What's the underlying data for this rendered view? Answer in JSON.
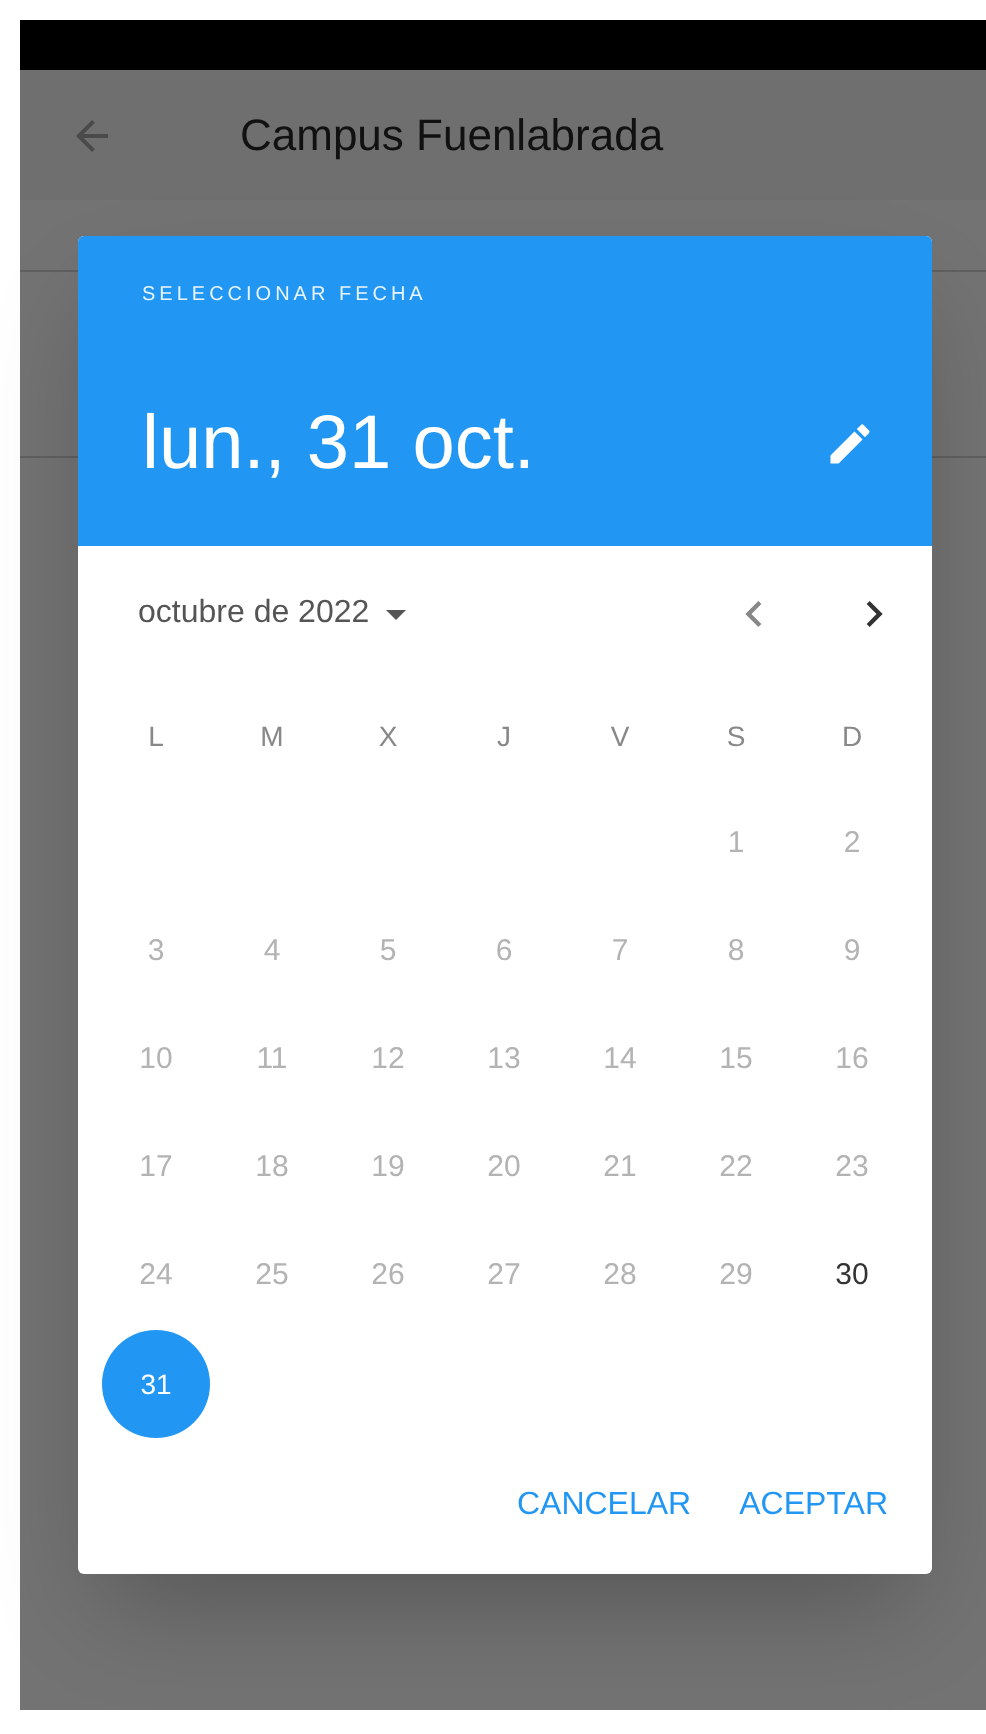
{
  "app_bar": {
    "title": "Campus Fuenlabrada"
  },
  "date_picker": {
    "header_label": "SELECCIONAR FECHA",
    "selected_date": "lun., 31 oct.",
    "month_label": "octubre de 2022",
    "weekdays": [
      "L",
      "M",
      "X",
      "J",
      "V",
      "S",
      "D"
    ],
    "weeks": [
      [
        {
          "kind": "blank"
        },
        {
          "kind": "blank"
        },
        {
          "kind": "blank"
        },
        {
          "kind": "blank"
        },
        {
          "kind": "blank"
        },
        {
          "kind": "day",
          "label": "1",
          "disabled": true,
          "selected": false
        },
        {
          "kind": "day",
          "label": "2",
          "disabled": true,
          "selected": false
        }
      ],
      [
        {
          "kind": "day",
          "label": "3",
          "disabled": true,
          "selected": false
        },
        {
          "kind": "day",
          "label": "4",
          "disabled": true,
          "selected": false
        },
        {
          "kind": "day",
          "label": "5",
          "disabled": true,
          "selected": false
        },
        {
          "kind": "day",
          "label": "6",
          "disabled": true,
          "selected": false
        },
        {
          "kind": "day",
          "label": "7",
          "disabled": true,
          "selected": false
        },
        {
          "kind": "day",
          "label": "8",
          "disabled": true,
          "selected": false
        },
        {
          "kind": "day",
          "label": "9",
          "disabled": true,
          "selected": false
        }
      ],
      [
        {
          "kind": "day",
          "label": "10",
          "disabled": true,
          "selected": false
        },
        {
          "kind": "day",
          "label": "11",
          "disabled": true,
          "selected": false
        },
        {
          "kind": "day",
          "label": "12",
          "disabled": true,
          "selected": false
        },
        {
          "kind": "day",
          "label": "13",
          "disabled": true,
          "selected": false
        },
        {
          "kind": "day",
          "label": "14",
          "disabled": true,
          "selected": false
        },
        {
          "kind": "day",
          "label": "15",
          "disabled": true,
          "selected": false
        },
        {
          "kind": "day",
          "label": "16",
          "disabled": true,
          "selected": false
        }
      ],
      [
        {
          "kind": "day",
          "label": "17",
          "disabled": true,
          "selected": false
        },
        {
          "kind": "day",
          "label": "18",
          "disabled": true,
          "selected": false
        },
        {
          "kind": "day",
          "label": "19",
          "disabled": true,
          "selected": false
        },
        {
          "kind": "day",
          "label": "20",
          "disabled": true,
          "selected": false
        },
        {
          "kind": "day",
          "label": "21",
          "disabled": true,
          "selected": false
        },
        {
          "kind": "day",
          "label": "22",
          "disabled": true,
          "selected": false
        },
        {
          "kind": "day",
          "label": "23",
          "disabled": true,
          "selected": false
        }
      ],
      [
        {
          "kind": "day",
          "label": "24",
          "disabled": true,
          "selected": false
        },
        {
          "kind": "day",
          "label": "25",
          "disabled": true,
          "selected": false
        },
        {
          "kind": "day",
          "label": "26",
          "disabled": true,
          "selected": false
        },
        {
          "kind": "day",
          "label": "27",
          "disabled": true,
          "selected": false
        },
        {
          "kind": "day",
          "label": "28",
          "disabled": true,
          "selected": false
        },
        {
          "kind": "day",
          "label": "29",
          "disabled": true,
          "selected": false
        },
        {
          "kind": "day",
          "label": "30",
          "disabled": false,
          "selected": false
        }
      ],
      [
        {
          "kind": "day",
          "label": "31",
          "disabled": false,
          "selected": true
        }
      ]
    ],
    "buttons": [
      "CANCELAR",
      "ACEPTAR"
    ]
  }
}
